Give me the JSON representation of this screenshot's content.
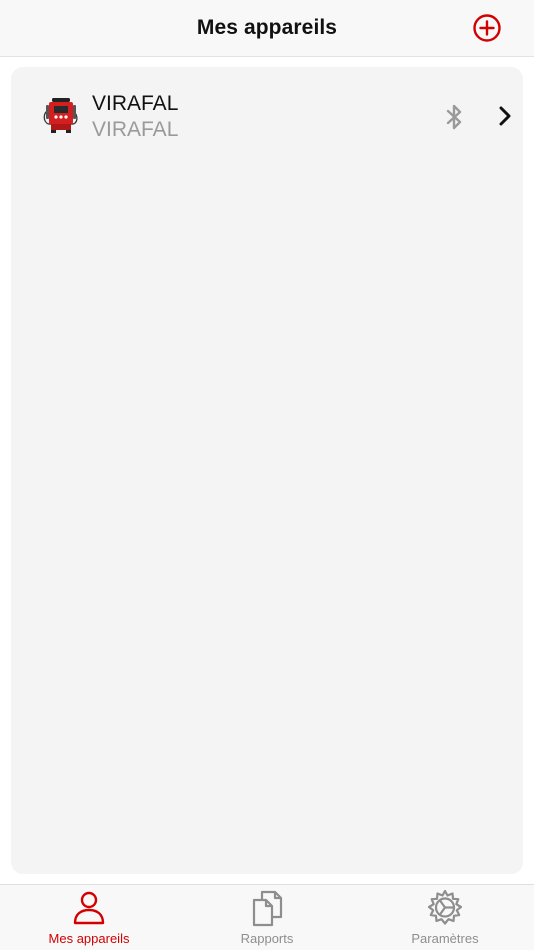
{
  "header": {
    "title": "Mes appareils"
  },
  "devices": [
    {
      "name": "VIRAFAL",
      "model": "VIRAFAL"
    }
  ],
  "tabs": [
    {
      "label": "Mes appareils",
      "active": true
    },
    {
      "label": "Rapports",
      "active": false
    },
    {
      "label": "Paramètres",
      "active": false
    }
  ],
  "colors": {
    "accent": "#d40000",
    "inactive": "#8e8e8e",
    "card_bg": "#f4f4f4",
    "bar_bg": "#f8f8f8"
  },
  "icons": {
    "add": "plus-circle-icon",
    "bluetooth": "bluetooth-icon",
    "chevron": "chevron-right-icon",
    "tab_devices": "person-icon",
    "tab_reports": "documents-icon",
    "tab_settings": "gear-icon"
  }
}
